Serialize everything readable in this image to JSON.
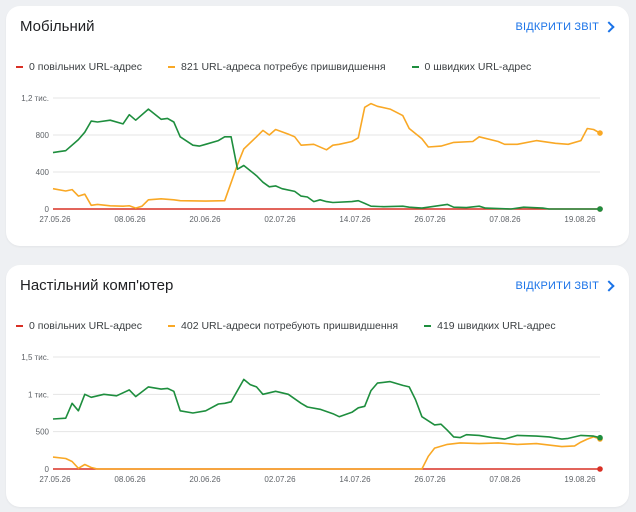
{
  "colors": {
    "slow": "#d93025",
    "improve": "#f9a825",
    "fast": "#1e8e3e",
    "grid": "#e6e6e6",
    "link": "#1a73e8"
  },
  "mobile": {
    "title": "Мобільний",
    "open_report": "ВІДКРИТИ ЗВІТ",
    "legend": {
      "slow": "0 повільних URL-адрес",
      "improve": "821 URL-адреса потребує пришвидшення",
      "fast": "0 швидких URL-адрес"
    }
  },
  "desktop": {
    "title": "Настільний комп'ютер",
    "open_report": "ВІДКРИТИ ЗВІТ",
    "legend": {
      "slow": "0 повільних URL-адрес",
      "improve": "402 URL-адреси потребують пришвидшення",
      "fast": "419 швидких URL-адрес"
    }
  },
  "chart_data": [
    {
      "type": "line",
      "title": "",
      "ylim": [
        0,
        1200
      ],
      "yticks": [
        {
          "value": 0,
          "label": "0"
        },
        {
          "value": 400,
          "label": "400"
        },
        {
          "value": 800,
          "label": "800"
        },
        {
          "value": 1200,
          "label": "1,2 тис."
        }
      ],
      "xticks": [
        "27.05.26",
        "08.06.26",
        "20.06.26",
        "02.07.26",
        "14.07.26",
        "26.07.26",
        "07.08.26",
        "19.08.26"
      ],
      "series": [
        {
          "name": "0 повільних URL-адрес",
          "color": "#d93025",
          "points": [
            [
              0,
              0
            ],
            [
              86,
              0
            ]
          ]
        },
        {
          "name": "821 URL-адреса потребує пришвидшення",
          "color": "#f9a825",
          "points": [
            [
              0,
              220
            ],
            [
              2,
              195
            ],
            [
              3,
              210
            ],
            [
              4,
              140
            ],
            [
              5,
              160
            ],
            [
              6,
              40
            ],
            [
              7,
              50
            ],
            [
              9,
              35
            ],
            [
              11,
              30
            ],
            [
              12,
              35
            ],
            [
              13,
              10
            ],
            [
              14,
              30
            ],
            [
              15,
              100
            ],
            [
              17,
              110
            ],
            [
              19,
              100
            ],
            [
              20,
              90
            ],
            [
              24,
              85
            ],
            [
              27,
              90
            ],
            [
              29,
              480
            ],
            [
              30,
              650
            ],
            [
              32,
              780
            ],
            [
              33,
              850
            ],
            [
              34,
              800
            ],
            [
              35,
              860
            ],
            [
              37,
              810
            ],
            [
              38,
              780
            ],
            [
              39,
              690
            ],
            [
              41,
              700
            ],
            [
              43,
              640
            ],
            [
              44,
              690
            ],
            [
              45,
              700
            ],
            [
              47,
              730
            ],
            [
              48,
              770
            ],
            [
              49,
              1100
            ],
            [
              50,
              1140
            ],
            [
              51,
              1110
            ],
            [
              53,
              1080
            ],
            [
              55,
              1010
            ],
            [
              56,
              870
            ],
            [
              58,
              760
            ],
            [
              59,
              670
            ],
            [
              61,
              680
            ],
            [
              63,
              720
            ],
            [
              66,
              730
            ],
            [
              67,
              780
            ],
            [
              70,
              730
            ],
            [
              71,
              700
            ],
            [
              73,
              700
            ],
            [
              76,
              740
            ],
            [
              79,
              710
            ],
            [
              81,
              700
            ],
            [
              83,
              740
            ],
            [
              84,
              870
            ],
            [
              85,
              860
            ],
            [
              86,
              821
            ]
          ]
        },
        {
          "name": "0 швидких URL-адрес",
          "color": "#1e8e3e",
          "points": [
            [
              0,
              610
            ],
            [
              1,
              620
            ],
            [
              2,
              630
            ],
            [
              4,
              750
            ],
            [
              5,
              830
            ],
            [
              6,
              950
            ],
            [
              7,
              940
            ],
            [
              9,
              960
            ],
            [
              11,
              920
            ],
            [
              12,
              1020
            ],
            [
              13,
              960
            ],
            [
              15,
              1080
            ],
            [
              17,
              970
            ],
            [
              18,
              980
            ],
            [
              19,
              940
            ],
            [
              20,
              780
            ],
            [
              22,
              690
            ],
            [
              23,
              680
            ],
            [
              24,
              700
            ],
            [
              26,
              740
            ],
            [
              27,
              780
            ],
            [
              28,
              780
            ],
            [
              29,
              430
            ],
            [
              30,
              470
            ],
            [
              32,
              360
            ],
            [
              33,
              290
            ],
            [
              34,
              240
            ],
            [
              35,
              250
            ],
            [
              36,
              220
            ],
            [
              38,
              190
            ],
            [
              39,
              140
            ],
            [
              40,
              130
            ],
            [
              41,
              80
            ],
            [
              42,
              100
            ],
            [
              43,
              80
            ],
            [
              44,
              70
            ],
            [
              47,
              80
            ],
            [
              48,
              90
            ],
            [
              49,
              60
            ],
            [
              50,
              30
            ],
            [
              52,
              25
            ],
            [
              55,
              30
            ],
            [
              56,
              20
            ],
            [
              58,
              10
            ],
            [
              62,
              50
            ],
            [
              63,
              20
            ],
            [
              65,
              15
            ],
            [
              67,
              30
            ],
            [
              68,
              10
            ],
            [
              72,
              0
            ],
            [
              74,
              20
            ],
            [
              77,
              10
            ],
            [
              78,
              0
            ],
            [
              86,
              0
            ]
          ]
        }
      ]
    },
    {
      "type": "line",
      "title": "",
      "ylim": [
        0,
        1500
      ],
      "yticks": [
        {
          "value": 0,
          "label": "0"
        },
        {
          "value": 500,
          "label": "500"
        },
        {
          "value": 1000,
          "label": "1 тис."
        },
        {
          "value": 1500,
          "label": "1,5 тис."
        }
      ],
      "xticks": [
        "27.05.26",
        "08.06.26",
        "20.06.26",
        "02.07.26",
        "14.07.26",
        "26.07.26",
        "07.08.26",
        "19.08.26"
      ],
      "series": [
        {
          "name": "0 повільних URL-адрес",
          "color": "#d93025",
          "points": [
            [
              0,
              0
            ],
            [
              86,
              0
            ]
          ]
        },
        {
          "name": "402 URL-адреси потребують пришвидшення",
          "color": "#f9a825",
          "points": [
            [
              0,
              160
            ],
            [
              2,
              140
            ],
            [
              3,
              100
            ],
            [
              4,
              10
            ],
            [
              5,
              60
            ],
            [
              6,
              20
            ],
            [
              7,
              0
            ],
            [
              58,
              0
            ],
            [
              59,
              170
            ],
            [
              60,
              280
            ],
            [
              62,
              330
            ],
            [
              64,
              350
            ],
            [
              67,
              340
            ],
            [
              70,
              350
            ],
            [
              73,
              330
            ],
            [
              76,
              340
            ],
            [
              78,
              320
            ],
            [
              80,
              300
            ],
            [
              82,
              310
            ],
            [
              83,
              360
            ],
            [
              84,
              400
            ],
            [
              85,
              430
            ],
            [
              86,
              402
            ]
          ]
        },
        {
          "name": "419 швидких URL-адрес",
          "color": "#1e8e3e",
          "points": [
            [
              0,
              670
            ],
            [
              2,
              680
            ],
            [
              3,
              880
            ],
            [
              4,
              780
            ],
            [
              5,
              1000
            ],
            [
              6,
              960
            ],
            [
              8,
              1000
            ],
            [
              10,
              980
            ],
            [
              12,
              1060
            ],
            [
              13,
              970
            ],
            [
              15,
              1100
            ],
            [
              17,
              1070
            ],
            [
              18,
              1080
            ],
            [
              19,
              1040
            ],
            [
              20,
              780
            ],
            [
              22,
              750
            ],
            [
              24,
              780
            ],
            [
              26,
              870
            ],
            [
              27,
              880
            ],
            [
              28,
              900
            ],
            [
              30,
              1200
            ],
            [
              31,
              1130
            ],
            [
              32,
              1100
            ],
            [
              33,
              1000
            ],
            [
              35,
              1040
            ],
            [
              37,
              1000
            ],
            [
              38,
              940
            ],
            [
              39,
              880
            ],
            [
              40,
              830
            ],
            [
              42,
              800
            ],
            [
              44,
              740
            ],
            [
              45,
              700
            ],
            [
              47,
              760
            ],
            [
              48,
              820
            ],
            [
              49,
              840
            ],
            [
              50,
              1050
            ],
            [
              51,
              1150
            ],
            [
              53,
              1170
            ],
            [
              55,
              1120
            ],
            [
              56,
              1100
            ],
            [
              57,
              930
            ],
            [
              58,
              700
            ],
            [
              60,
              590
            ],
            [
              61,
              600
            ],
            [
              62,
              520
            ],
            [
              63,
              430
            ],
            [
              64,
              420
            ],
            [
              65,
              460
            ],
            [
              67,
              450
            ],
            [
              69,
              420
            ],
            [
              71,
              400
            ],
            [
              73,
              450
            ],
            [
              76,
              440
            ],
            [
              78,
              430
            ],
            [
              80,
              400
            ],
            [
              81,
              410
            ],
            [
              83,
              450
            ],
            [
              85,
              440
            ],
            [
              86,
              419
            ]
          ]
        }
      ]
    }
  ]
}
